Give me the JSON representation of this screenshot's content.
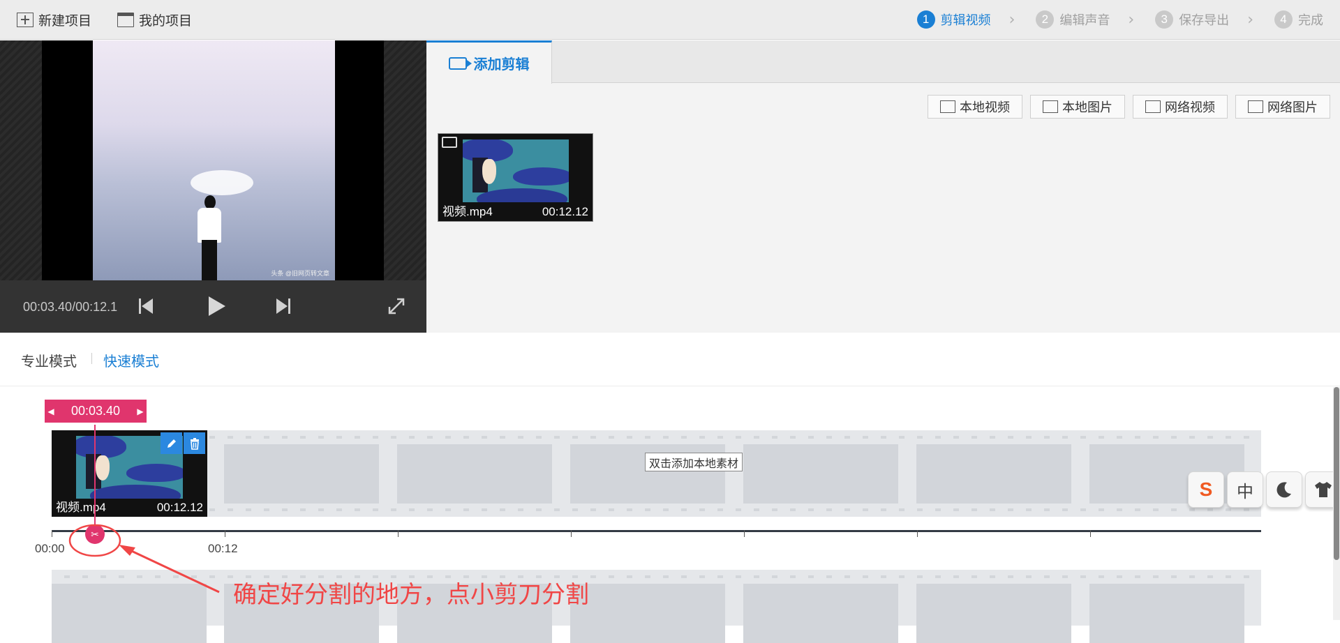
{
  "toolbar": {
    "new_project": "新建项目",
    "my_projects": "我的项目"
  },
  "steps": [
    {
      "num": "1",
      "label": "剪辑视频",
      "active": true
    },
    {
      "num": "2",
      "label": "编辑声音",
      "active": false
    },
    {
      "num": "3",
      "label": "保存导出",
      "active": false
    },
    {
      "num": "4",
      "label": "完成",
      "active": false
    }
  ],
  "player": {
    "time": "00:03.40/00:12.1",
    "watermark": "头条 @旧网页转文章"
  },
  "panel": {
    "tab_label": "添加剪辑",
    "source_buttons": [
      "本地视频",
      "本地图片",
      "网络视频",
      "网络图片"
    ],
    "media": [
      {
        "name": "视频.mp4",
        "duration": "00:12.12"
      }
    ]
  },
  "modes": {
    "pro": "专业模式",
    "quick": "快速模式",
    "active": "quick"
  },
  "timeline": {
    "playhead_time": "00:03.40",
    "clip": {
      "name": "视频.mp4",
      "duration": "00:12.12"
    },
    "tick_labels": [
      "00:00",
      "00:12"
    ],
    "empty_hint": "双击添加本地素材"
  },
  "annotation": "确定好分割的地方，点小剪刀分割",
  "ime": [
    "S",
    "中",
    "moon",
    "shirt"
  ],
  "colors": {
    "accent": "#1a7fd4",
    "playhead": "#e0356d",
    "annotation": "#f04646"
  }
}
